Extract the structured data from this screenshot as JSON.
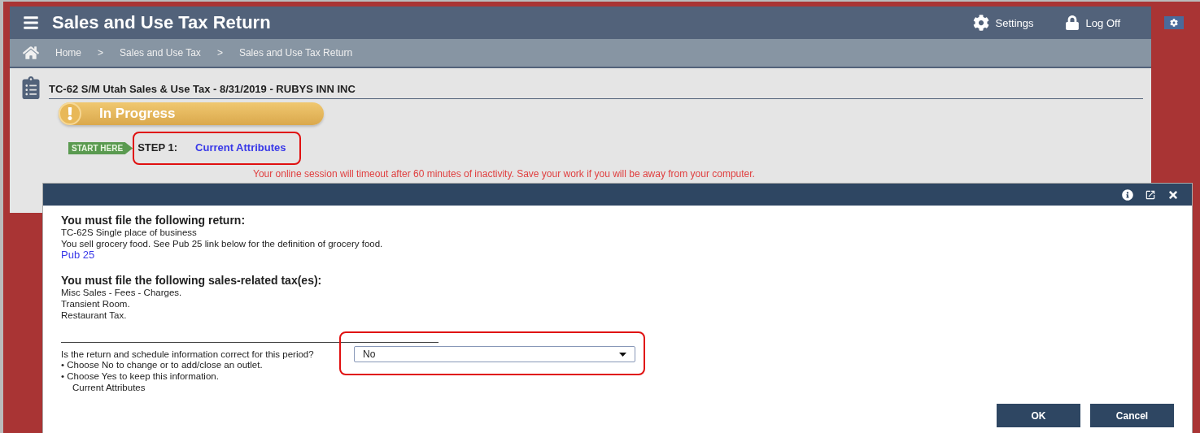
{
  "header": {
    "title": "Sales and Use Tax Return",
    "settings": "Settings",
    "logoff": "Log Off"
  },
  "breadcrumb": {
    "separator": ">",
    "items": [
      "Home",
      "Sales and Use Tax",
      "Sales and Use Tax Return"
    ]
  },
  "return_title": "TC-62 S/M Utah Sales & Use Tax - 8/31/2019 - RUBYS INN INC",
  "status": "In Progress",
  "start_badge": "START HERE",
  "step": {
    "label": "STEP 1:",
    "link": "Current Attributes"
  },
  "timeout_message": "Your online session will timeout after 60 minutes of inactivity. Save your work if you will be away from your computer.",
  "dialog": {
    "sections": [
      {
        "heading": "You must file the following return:",
        "lines": [
          "TC-62S Single place of business",
          "You sell grocery food. See Pub 25 link below for the definition of grocery food."
        ],
        "link": "Pub 25"
      },
      {
        "heading": "You must file the following sales-related tax(es):",
        "lines": [
          "Misc Sales - Fees - Charges.",
          "Transient Room.",
          "Restaurant Tax."
        ]
      }
    ],
    "question": "Is the return and schedule information correct for this period?",
    "select": {
      "value": "No"
    },
    "bullets": [
      {
        "marker": "•",
        "text": "Choose No to change or to add/close an outlet."
      },
      {
        "marker": "•",
        "text": "Choose Yes to keep this information."
      }
    ],
    "note": "Current Attributes",
    "buttons": [
      "OK",
      "Cancel"
    ]
  }
}
